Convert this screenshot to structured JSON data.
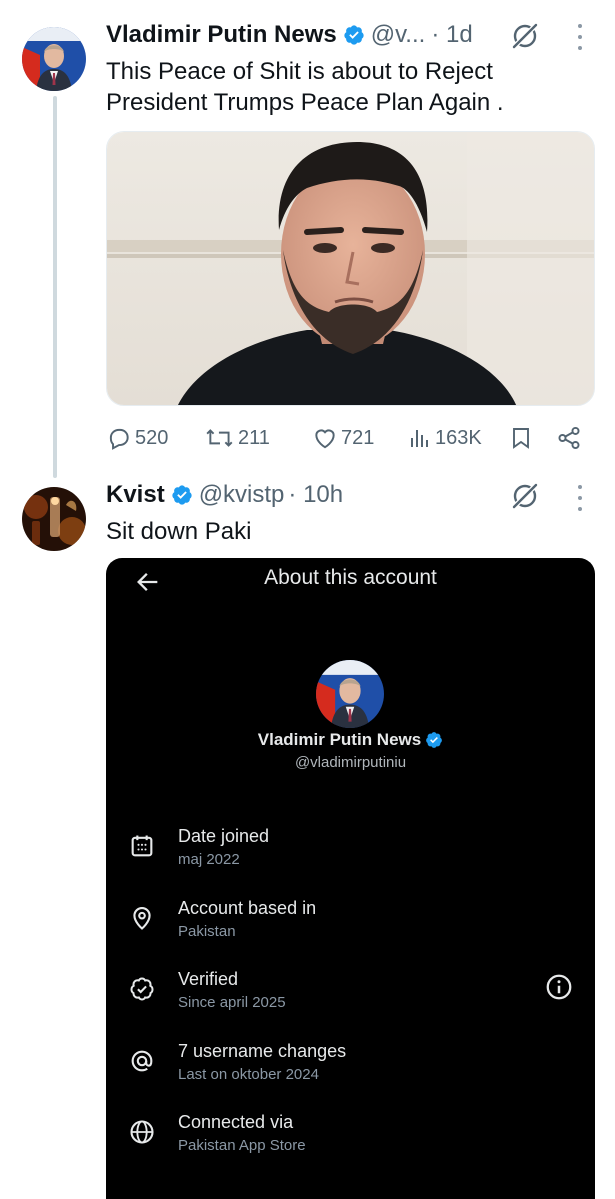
{
  "colors": {
    "accent": "#1d9bf0",
    "text": "#0f1419",
    "secondary": "#536471",
    "card_bg": "#000000"
  },
  "tweet1": {
    "author_name": "Vladimir Putin News",
    "handle": "@v...",
    "time": "· 1d",
    "text_line1": "This Peace of Shit is about to Reject",
    "text_line2": "President Trumps Peace Plan Again .",
    "actions": {
      "replies": "520",
      "reposts": "211",
      "likes": "721",
      "views": "163K"
    }
  },
  "tweet2": {
    "author_name": "Kvist",
    "handle": "@kvistp",
    "time": "· 10h",
    "text": "Sit down Paki",
    "about_card": {
      "title": "About this account",
      "name": "Vladimir Putin News",
      "handle": "@vladimirputiniu",
      "rows": [
        {
          "icon": "calendar-icon",
          "label": "Date joined",
          "value": "maj 2022"
        },
        {
          "icon": "location-pin-icon",
          "label": "Account based in",
          "value": "Pakistan"
        },
        {
          "icon": "verified-check-icon",
          "label": "Verified",
          "value": "Since april 2025"
        },
        {
          "icon": "at-sign-icon",
          "label": "7 username changes",
          "value": "Last on oktober 2024"
        },
        {
          "icon": "globe-icon",
          "label": "Connected via",
          "value": "Pakistan App Store"
        }
      ]
    }
  }
}
